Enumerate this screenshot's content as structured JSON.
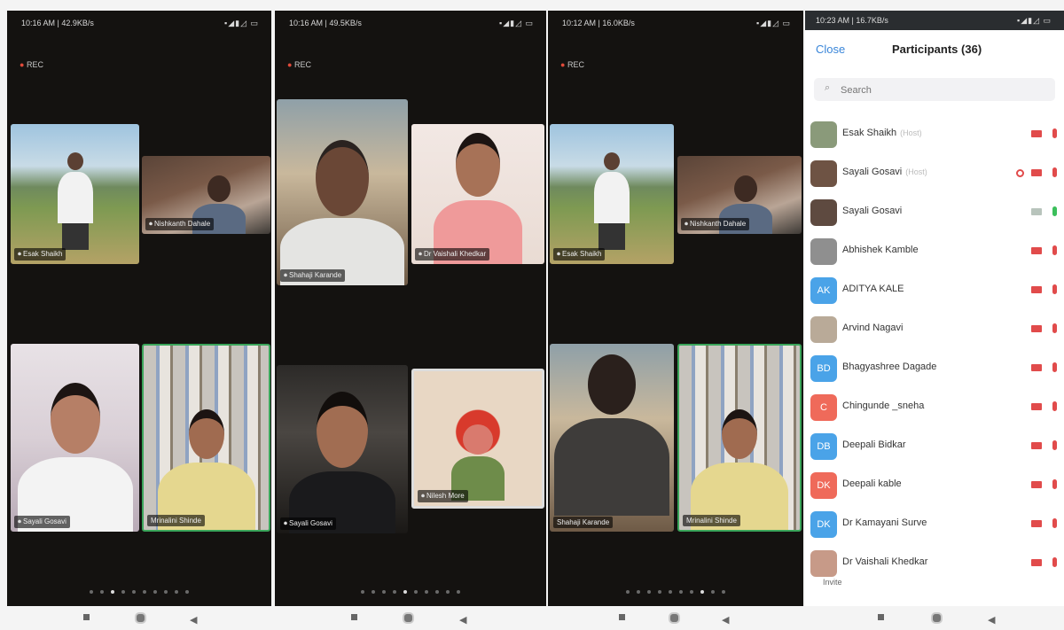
{
  "screens": [
    {
      "status": {
        "time": "10:16 AM | 42.9KB/s",
        "icons": "▪◢▮◿ ▭"
      },
      "rec": "REC",
      "tiles": [
        {
          "name": "Esak Shaikh"
        },
        {
          "name": "Nishkanth Dahale"
        },
        {
          "name": "Sayali Gosavi"
        },
        {
          "name": "Mrinalini Shinde"
        }
      ]
    },
    {
      "status": {
        "time": "10:16 AM | 49.5KB/s",
        "icons": "▪◢▮◿ ▭"
      },
      "rec": "REC",
      "tiles": [
        {
          "name": "Shahaji Karande"
        },
        {
          "name": "Dr Vaishali Khedkar"
        },
        {
          "name": "Sayali Gosavi"
        },
        {
          "name": "Nilesh More"
        }
      ]
    },
    {
      "status": {
        "time": "10:12 AM | 16.0KB/s",
        "icons": "▪◢▮◿ ▭"
      },
      "rec": "REC",
      "tiles": [
        {
          "name": "Esak Shaikh"
        },
        {
          "name": "Nishkanth Dahale"
        },
        {
          "name": "Shahaji Karande"
        },
        {
          "name": "Mrinalini Shinde"
        }
      ]
    }
  ],
  "participants_panel": {
    "status": {
      "time": "10:23 AM | 16.7KB/s",
      "icons": "▪◢▮◿ ▭"
    },
    "close_label": "Close",
    "title": "Participants (36)",
    "search_placeholder": "Search",
    "invite_label": "Invite",
    "participants": [
      {
        "name": "Esak Shaikh",
        "tag": "(Host)",
        "avatar": "",
        "avatar_color": "#8a9a7a",
        "video": "off",
        "mic": "muted",
        "sharing": false
      },
      {
        "name": "Sayali Gosavi",
        "tag": "(Host)",
        "avatar": "",
        "avatar_color": "#6e5344",
        "video": "off",
        "mic": "muted",
        "sharing": true
      },
      {
        "name": "Sayali Gosavi",
        "tag": "",
        "avatar": "",
        "avatar_color": "#5e4a40",
        "video": "on",
        "mic": "on",
        "sharing": false
      },
      {
        "name": "Abhishek Kamble",
        "tag": "",
        "avatar": "",
        "avatar_color": "#8f8f8f",
        "video": "off",
        "mic": "muted",
        "sharing": false
      },
      {
        "name": "ADITYA KALE",
        "tag": "",
        "avatar": "AK",
        "avatar_color": "#4aa3e8",
        "video": "off",
        "mic": "muted",
        "sharing": false
      },
      {
        "name": "Arvind Nagavi",
        "tag": "",
        "avatar": "",
        "avatar_color": "#b9aa98",
        "video": "off",
        "mic": "muted",
        "sharing": false
      },
      {
        "name": "Bhagyashree Dagade",
        "tag": "",
        "avatar": "BD",
        "avatar_color": "#4aa3e8",
        "video": "off",
        "mic": "muted",
        "sharing": false
      },
      {
        "name": "Chingunde _sneha",
        "tag": "",
        "avatar": "C",
        "avatar_color": "#ef6a5a",
        "video": "off",
        "mic": "muted",
        "sharing": false
      },
      {
        "name": "Deepali Bidkar",
        "tag": "",
        "avatar": "DB",
        "avatar_color": "#4aa3e8",
        "video": "off",
        "mic": "muted",
        "sharing": false
      },
      {
        "name": "Deepali kable",
        "tag": "",
        "avatar": "DK",
        "avatar_color": "#ef6a5a",
        "video": "off",
        "mic": "muted",
        "sharing": false
      },
      {
        "name": "Dr Kamayani Surve",
        "tag": "",
        "avatar": "DK",
        "avatar_color": "#4aa3e8",
        "video": "off",
        "mic": "muted",
        "sharing": false
      },
      {
        "name": "Dr Vaishali Khedkar",
        "tag": "",
        "avatar": "",
        "avatar_color": "#c79a88",
        "video": "off",
        "mic": "muted",
        "sharing": false
      }
    ]
  },
  "icons": {
    "mic": "microphone-icon",
    "camera": "video-camera-icon",
    "search": "search-icon",
    "share": "screen-share-icon"
  },
  "colors": {
    "accent": "#3a86d9",
    "muted": "#e14b4b",
    "unmuted": "#3bbf5b",
    "active_speaker": "#3aa55a"
  }
}
